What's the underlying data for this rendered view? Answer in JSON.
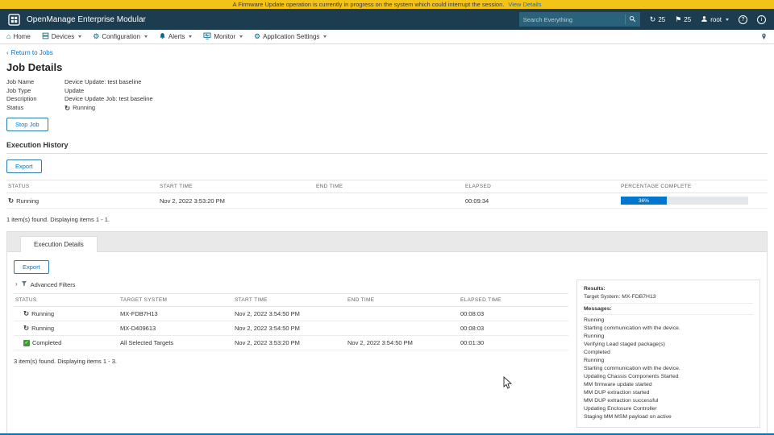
{
  "colors": {
    "accent": "#0076CE",
    "header_bg": "#1c3d50",
    "banner_bg": "#f3c318",
    "success": "#3f9c35"
  },
  "icons": {
    "running": "↻",
    "flag": "⚑",
    "check": "✓",
    "chevron_left": "‹",
    "chevron_right": "›",
    "home": "⌂",
    "gear": "⚙",
    "help": "?",
    "info": "i"
  },
  "banner": {
    "message": "A Firmware Update operation is currently in progress on the system which could interrupt the session.",
    "link_label": "View Details"
  },
  "header": {
    "app_title": "OpenManage Enterprise Modular",
    "search_placeholder": "Search Everything",
    "jobs_count": "25",
    "alerts_count": "25",
    "user": "root"
  },
  "nav": {
    "items": [
      {
        "label": "Home"
      },
      {
        "label": "Devices"
      },
      {
        "label": "Configuration"
      },
      {
        "label": "Alerts"
      },
      {
        "label": "Monitor"
      },
      {
        "label": "Application Settings"
      }
    ]
  },
  "breadcrumb": {
    "label": "Return to Jobs"
  },
  "job": {
    "title": "Job Details",
    "fields": [
      {
        "label": "Job Name",
        "value": "Device Update: test baseline"
      },
      {
        "label": "Job Type",
        "value": "Update"
      },
      {
        "label": "Description",
        "value": "Device Update Job: test baseline"
      },
      {
        "label": "Status",
        "value": "Running"
      }
    ],
    "stop_button": "Stop Job"
  },
  "history": {
    "title": "Execution History",
    "export_button": "Export",
    "columns": [
      "STATUS",
      "START TIME",
      "END TIME",
      "ELAPSED",
      "PERCENTAGE COMPLETE"
    ],
    "rows": [
      {
        "status": "Running",
        "start_time": "Nov 2, 2022 3:53:20 PM",
        "end_time": "",
        "elapsed": "00:09:34",
        "percent": 36,
        "percent_label": "36%"
      }
    ],
    "summary": "1 item(s) found. Displaying items 1 - 1."
  },
  "details": {
    "tab_label": "Execution Details",
    "export_button": "Export",
    "filters_label": "Advanced Filters",
    "columns": [
      "STATUS",
      "TARGET SYSTEM",
      "START TIME",
      "END TIME",
      "ELAPSED TIME"
    ],
    "rows": [
      {
        "status": "Running",
        "target_system": "MX-FDB7H13",
        "start_time": "Nov 2, 2022 3:54:50 PM",
        "end_time": "",
        "elapsed": "00:08:03"
      },
      {
        "status": "Running",
        "target_system": "MX-D409613",
        "start_time": "Nov 2, 2022 3:54:50 PM",
        "end_time": "",
        "elapsed": "00:08:03"
      },
      {
        "status": "Completed",
        "target_system": "All Selected Targets",
        "start_time": "Nov 2, 2022 3:53:20 PM",
        "end_time": "Nov 2, 2022 3:54:50 PM",
        "elapsed": "00:01:30"
      }
    ],
    "summary": "3 item(s) found. Displaying items 1 - 3.",
    "results": {
      "title": "Results:",
      "target": "Target System: MX-FDB7H13",
      "messages_title": "Messages:",
      "messages": [
        "Running",
        "Starting communication with the device.",
        "Running",
        "Verifying Lead staged package(s)",
        "Completed",
        "Running",
        "Starting communication with the device.",
        "Updating Chassis Components Started",
        "MM firmware update started",
        "MM DUP extraction started",
        "MM DUP extraction successful",
        "Updating Enclosure Controller",
        "Staging MM MSM payload on active"
      ]
    }
  }
}
